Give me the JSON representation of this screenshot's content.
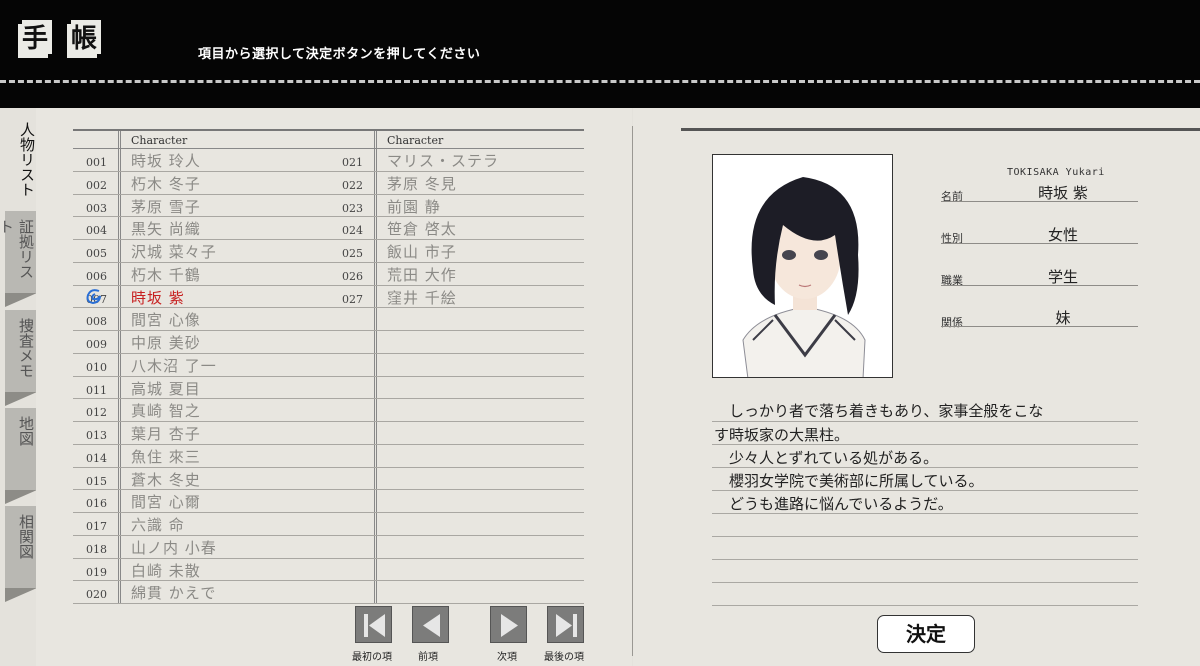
{
  "header": {
    "title_chars": [
      "手",
      "帳"
    ],
    "instruction": "項目から選択して決定ボタンを押してください"
  },
  "tabs": [
    {
      "label": "人物リスト",
      "active": true
    },
    {
      "label": "証拠リスト",
      "active": false
    },
    {
      "label": "捜査メモ",
      "active": false
    },
    {
      "label": "地図",
      "active": false
    },
    {
      "label": "相関図",
      "active": false
    }
  ],
  "list": {
    "column_header": "Character",
    "selected_number": "007",
    "left": [
      {
        "num": "001",
        "name": "時坂 玲人"
      },
      {
        "num": "002",
        "name": "朽木 冬子"
      },
      {
        "num": "003",
        "name": "茅原 雪子"
      },
      {
        "num": "004",
        "name": "黒矢 尚織"
      },
      {
        "num": "005",
        "name": "沢城 菜々子"
      },
      {
        "num": "006",
        "name": "朽木 千鶴"
      },
      {
        "num": "007",
        "name": "時坂 紫"
      },
      {
        "num": "008",
        "name": "間宮 心像"
      },
      {
        "num": "009",
        "name": "中原 美砂"
      },
      {
        "num": "010",
        "name": "八木沼 了一"
      },
      {
        "num": "011",
        "name": "高城 夏目"
      },
      {
        "num": "012",
        "name": "真崎 智之"
      },
      {
        "num": "013",
        "name": "葉月 杏子"
      },
      {
        "num": "014",
        "name": "魚住 來三"
      },
      {
        "num": "015",
        "name": "蒼木 冬史"
      },
      {
        "num": "016",
        "name": "間宮 心爾"
      },
      {
        "num": "017",
        "name": "六識 命"
      },
      {
        "num": "018",
        "name": "山ノ内 小春"
      },
      {
        "num": "019",
        "name": "白崎 未散"
      },
      {
        "num": "020",
        "name": "綿貫 かえで"
      }
    ],
    "right": [
      {
        "num": "021",
        "name": "マリス・ステラ"
      },
      {
        "num": "022",
        "name": "茅原 冬見"
      },
      {
        "num": "023",
        "name": "前園 静"
      },
      {
        "num": "024",
        "name": "笹倉 啓太"
      },
      {
        "num": "025",
        "name": "飯山 市子"
      },
      {
        "num": "026",
        "name": "荒田 大作"
      },
      {
        "num": "027",
        "name": "窪井 千絵"
      }
    ]
  },
  "nav": [
    {
      "label": "最初の項",
      "icon": "first-page-icon"
    },
    {
      "label": "前項",
      "icon": "previous-page-icon"
    },
    {
      "label": "次項",
      "icon": "next-page-icon"
    },
    {
      "label": "最後の項",
      "icon": "last-page-icon"
    }
  ],
  "profile": {
    "romaji": "TOKISAKA Yukari",
    "name_label": "名前",
    "name": "時坂 紫",
    "gender_label": "性別",
    "gender": "女性",
    "job_label": "職業",
    "job": "学生",
    "relation_label": "関係",
    "relation": "妹",
    "description": [
      "　しっかり者で落ち着きもあり、家事全般をこな",
      "す時坂家の大黒柱。",
      "　少々人とずれている処がある。",
      "　櫻羽女学院で美術部に所属している。",
      "　どうも進路に悩んでいるようだ。"
    ]
  },
  "decide_label": "決定",
  "colors": {
    "selected_name": "#c72020",
    "selection_mark": "#2a6fd6"
  }
}
